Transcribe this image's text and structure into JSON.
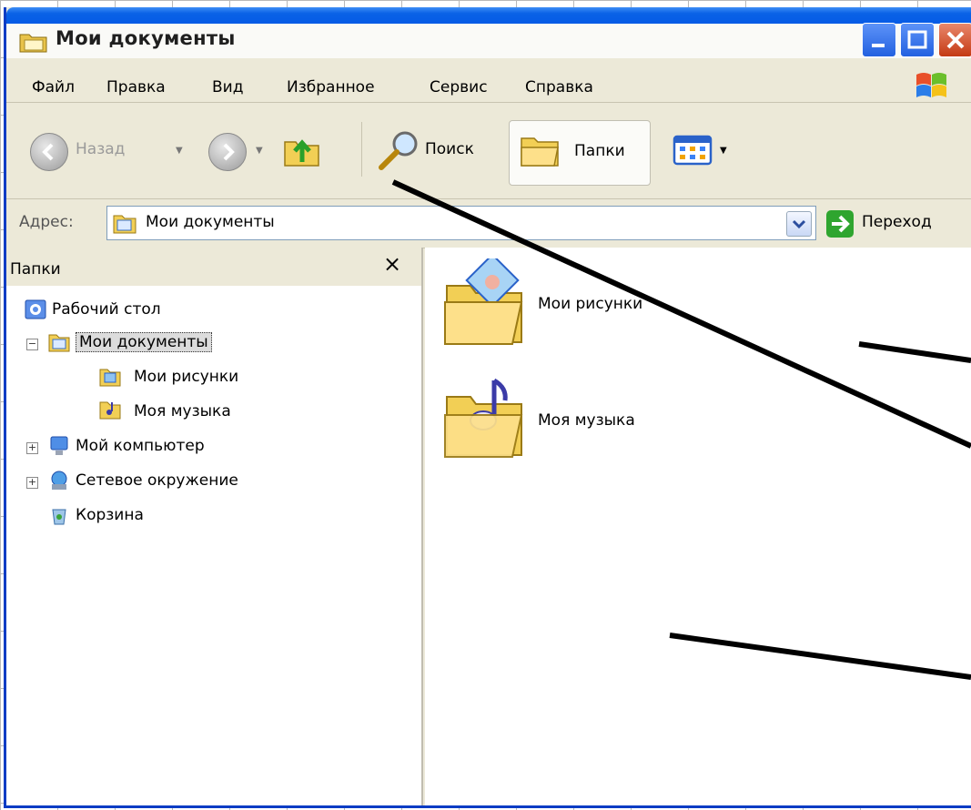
{
  "window": {
    "title": "Мои документы"
  },
  "menu": {
    "file": "Файл",
    "edit": "Правка",
    "view": "Вид",
    "favorites": "Избранное",
    "tools": "Сервис",
    "help": "Справка"
  },
  "toolbar": {
    "back_label": "Назад",
    "search_label": "Поиск",
    "folders_label": "Папки"
  },
  "address": {
    "label": "Адрес:",
    "value": "Мои документы",
    "go_label": "Переход"
  },
  "folders_pane": {
    "title": "Папки",
    "close_glyph": "×",
    "tree": {
      "desktop": "Рабочий стол",
      "my_documents": "Мои документы",
      "my_pictures": "Мои рисунки",
      "my_music": "Моя музыка",
      "my_computer": "Мой компьютер",
      "network": "Сетевое окружение",
      "recycle_bin": "Корзина"
    }
  },
  "content": {
    "items": [
      {
        "label": "Мои рисунки",
        "icon": "pictures-folder-icon"
      },
      {
        "label": "Моя музыка",
        "icon": "music-folder-icon"
      }
    ]
  },
  "colors": {
    "titlebar": "#0055e5",
    "chrome": "#ece9d8",
    "go_arrow": "#2fa52f"
  }
}
